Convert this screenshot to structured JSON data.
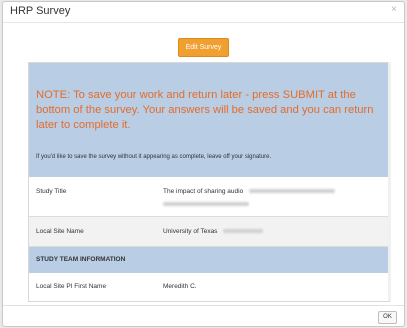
{
  "dialog": {
    "title": "HRP Survey",
    "close_glyph": "×"
  },
  "toolbar": {
    "edit_label": "Edit Survey"
  },
  "note": {
    "text": "NOTE: To save your work and return later - press SUBMIT at the bottom of the survey. Your answers will be saved and you can return later to complete it.",
    "subtext": "If you'd like to save the survey without it appearing as complete, leave off your signature."
  },
  "fields": {
    "study_title": {
      "label": "Study Title",
      "value": "The impact of sharing audio"
    },
    "local_site_name": {
      "label": "Local Site Name",
      "value": "University of Texas"
    },
    "section_team": {
      "label": "STUDY TEAM INFORMATION"
    },
    "pi_first_name": {
      "label": "Local Site PI First Name",
      "value": "Meredith C."
    }
  },
  "footer": {
    "ok_label": "OK"
  },
  "colors": {
    "accent_orange": "#f0a030",
    "note_text": "#e36c2a",
    "panel_blue": "#b9cde5"
  }
}
